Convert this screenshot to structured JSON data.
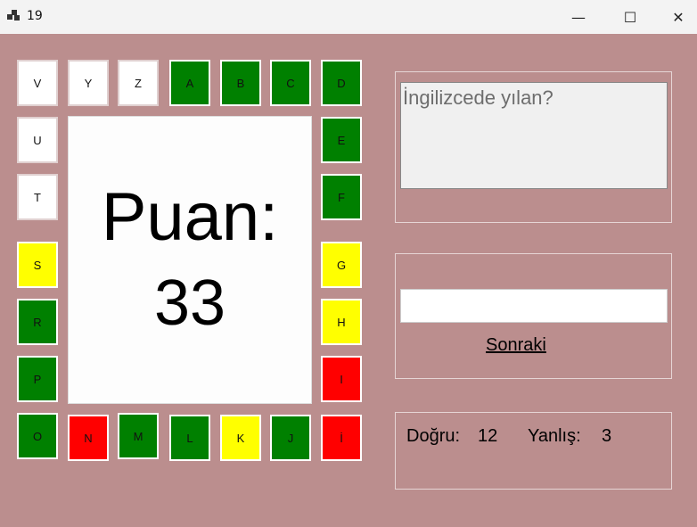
{
  "window": {
    "title": "19",
    "minimize_label": "—",
    "maximize_label": "☐",
    "close_label": "✕"
  },
  "colors": {
    "background": "#bb8e8e",
    "green": "#008000",
    "yellow": "#ffff00",
    "red": "#ff0000",
    "white": "#ffffff"
  },
  "letters": [
    {
      "letter": "A",
      "color": "#008000"
    },
    {
      "letter": "B",
      "color": "#008000"
    },
    {
      "letter": "C",
      "color": "#008000"
    },
    {
      "letter": "D",
      "color": "#008000"
    },
    {
      "letter": "E",
      "color": "#008000"
    },
    {
      "letter": "F",
      "color": "#008000"
    },
    {
      "letter": "G",
      "color": "#ffff00"
    },
    {
      "letter": "H",
      "color": "#ffff00"
    },
    {
      "letter": "I",
      "color": "#ff0000"
    },
    {
      "letter": "İ",
      "color": "#ff0000"
    },
    {
      "letter": "J",
      "color": "#008000"
    },
    {
      "letter": "K",
      "color": "#ffff00"
    },
    {
      "letter": "L",
      "color": "#008000"
    },
    {
      "letter": "M",
      "color": "#008000"
    },
    {
      "letter": "N",
      "color": "#ff0000"
    },
    {
      "letter": "O",
      "color": "#008000"
    },
    {
      "letter": "P",
      "color": "#008000"
    },
    {
      "letter": "R",
      "color": "#008000"
    },
    {
      "letter": "S",
      "color": "#ffff00"
    },
    {
      "letter": "T",
      "color": "#ffffff"
    },
    {
      "letter": "U",
      "color": "#ffffff"
    },
    {
      "letter": "V",
      "color": "#ffffff"
    },
    {
      "letter": "Y",
      "color": "#ffffff"
    },
    {
      "letter": "Z",
      "color": "#ffffff"
    }
  ],
  "score": {
    "label": "Puan:",
    "value": "33"
  },
  "question": {
    "text": "İngilizcede yılan?"
  },
  "answer": {
    "value": "",
    "placeholder": ""
  },
  "next_label": "Sonraki",
  "stats": {
    "correct_label": "Doğru:",
    "correct_value": "12",
    "wrong_label": "Yanlış:",
    "wrong_value": "3"
  }
}
